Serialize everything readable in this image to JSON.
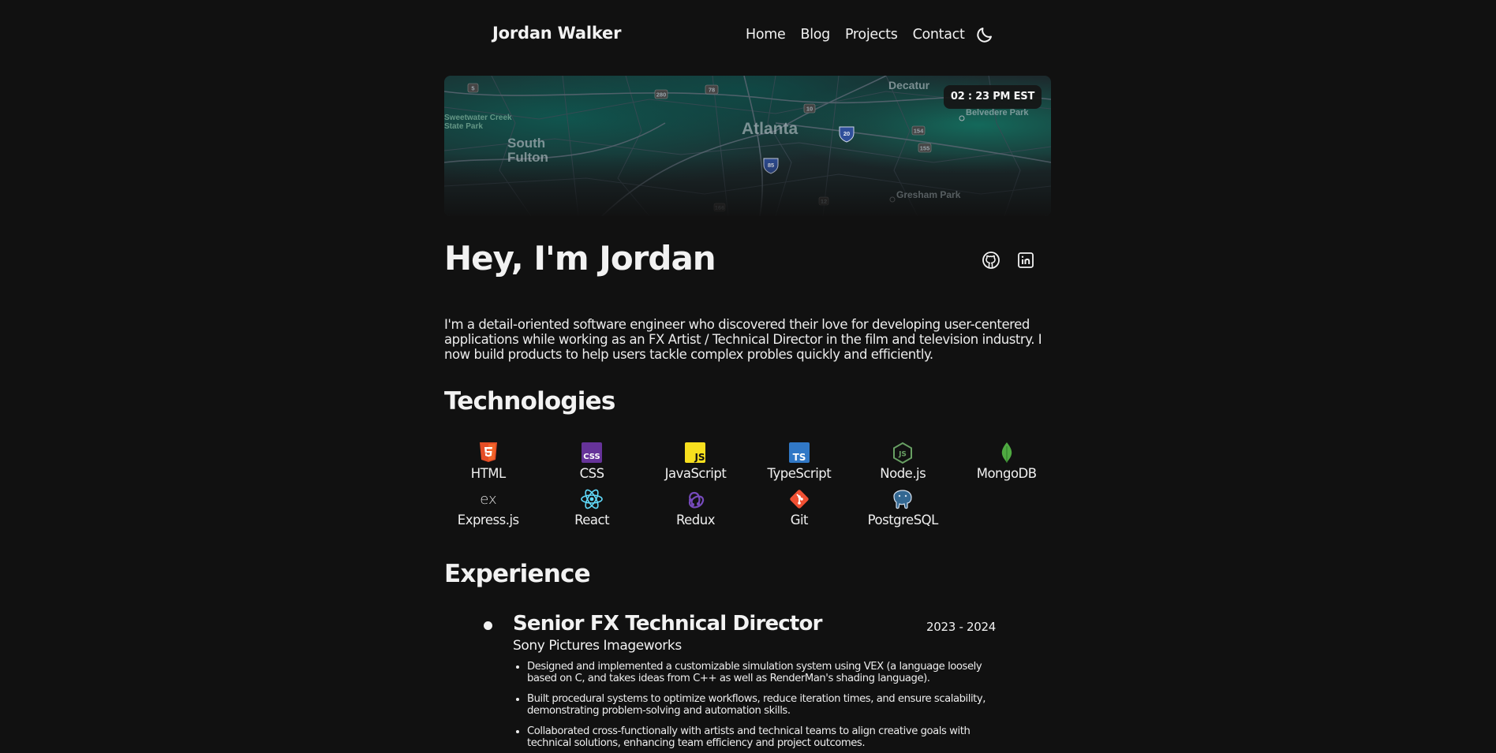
{
  "header": {
    "brand": "Jordan Walker",
    "nav": [
      "Home",
      "Blog",
      "Projects",
      "Contact"
    ],
    "theme_toggle_icon": "moon-icon"
  },
  "map": {
    "time": "02 : 23 PM EST",
    "labels": {
      "atlanta": "Atlanta",
      "decatur": "Decatur",
      "south": "South",
      "fulton": "Fulton",
      "sweetwater": "Sweetwater Creek",
      "state_park": "State Park",
      "belvedere": "Belvedere Park",
      "gresham": "Gresham Park"
    },
    "shields": [
      "5",
      "280",
      "78",
      "10",
      "20",
      "154",
      "155",
      "85",
      "166",
      "12"
    ]
  },
  "hero": {
    "title": "Hey, I'm Jordan",
    "bio": "I'm a detail-oriented software engineer who discovered their love for developing user-centered applications while working as an FX Artist / Technical Director in the film and television industry. I now build products to help users tackle complex probles quickly and efficiently.",
    "social": [
      "github-icon",
      "linkedin-icon"
    ]
  },
  "technologies": {
    "title": "Technologies",
    "items": [
      {
        "name": "HTML",
        "icon": "html5-icon",
        "color": "#e44d26"
      },
      {
        "name": "CSS",
        "icon": "css3-icon",
        "color": "#663399"
      },
      {
        "name": "JavaScript",
        "icon": "javascript-icon",
        "color": "#f7df1e"
      },
      {
        "name": "TypeScript",
        "icon": "typescript-icon",
        "color": "#3178c6"
      },
      {
        "name": "Node.js",
        "icon": "nodejs-icon",
        "color": "#68a063"
      },
      {
        "name": "MongoDB",
        "icon": "mongodb-icon",
        "color": "#4faa41"
      },
      {
        "name": "Express.js",
        "icon": "express-icon",
        "color": "#dddddd"
      },
      {
        "name": "React",
        "icon": "react-icon",
        "color": "#61dafb"
      },
      {
        "name": "Redux",
        "icon": "redux-icon",
        "color": "#764abc"
      },
      {
        "name": "Git",
        "icon": "git-icon",
        "color": "#f05033"
      },
      {
        "name": "PostgreSQL",
        "icon": "postgresql-icon",
        "color": "#336791"
      }
    ]
  },
  "experience": {
    "title": "Experience",
    "jobs": [
      {
        "role": "Senior FX Technical Director",
        "company": "Sony Pictures Imageworks",
        "dates": "2023 - 2024",
        "points": [
          "Designed and implemented a customizable simulation system using VEX (a language loosely based on C, and takes ideas from C++ as well as RenderMan's shading language).",
          "Built procedural systems to optimize workflows, reduce iteration times, and ensure scalability, demonstrating problem-solving and automation skills.",
          "Collaborated cross-functionally with artists and technical teams to align creative goals with technical solutions, enhancing team efficiency and project outcomes."
        ]
      }
    ]
  }
}
